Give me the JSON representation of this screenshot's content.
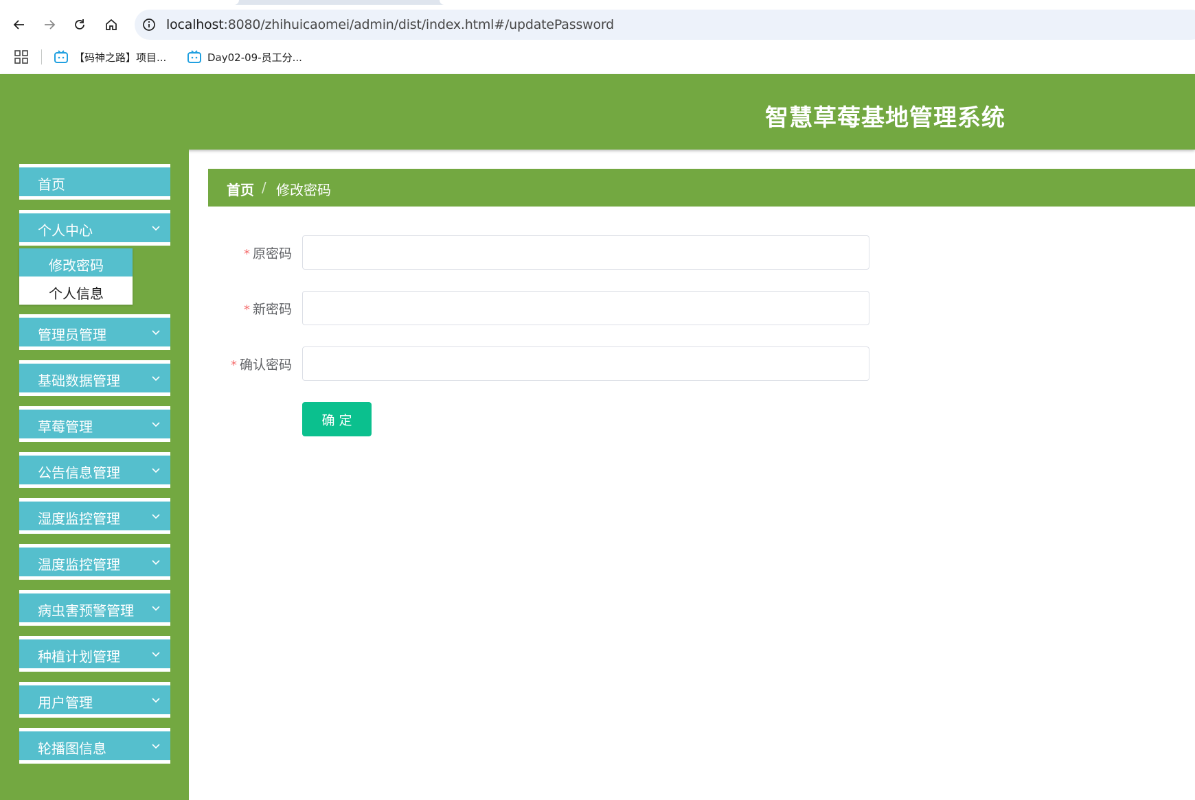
{
  "browser": {
    "url_host": "localhost",
    "url_rest": ":8080/zhihuicaomei/admin/dist/index.html#/updatePassword",
    "bookmarks": [
      {
        "label": "【码神之路】项目..."
      },
      {
        "label": "Day02-09-员工分..."
      }
    ],
    "accent": "#1a73e8"
  },
  "header": {
    "title": "智慧草莓基地管理系统",
    "bg_color": "#73a841"
  },
  "sidebar": {
    "items": [
      {
        "label": "首页",
        "has_chevron": false
      },
      {
        "label": "个人中心",
        "has_chevron": true,
        "expanded": true
      },
      {
        "label": "管理员管理",
        "has_chevron": true
      },
      {
        "label": "基础数据管理",
        "has_chevron": true
      },
      {
        "label": "草莓管理",
        "has_chevron": true
      },
      {
        "label": "公告信息管理",
        "has_chevron": true
      },
      {
        "label": "湿度监控管理",
        "has_chevron": true
      },
      {
        "label": "温度监控管理",
        "has_chevron": true
      },
      {
        "label": "病虫害预警管理",
        "has_chevron": true
      },
      {
        "label": "种植计划管理",
        "has_chevron": true
      },
      {
        "label": "用户管理",
        "has_chevron": true
      },
      {
        "label": "轮播图信息",
        "has_chevron": true
      }
    ],
    "submenu": [
      {
        "label": "修改密码",
        "active": true
      },
      {
        "label": "个人信息",
        "active": false
      }
    ],
    "item_color": "#55bfcd"
  },
  "breadcrumb": {
    "home": "首页",
    "separator": "/",
    "current": "修改密码"
  },
  "form": {
    "required_mark": "*",
    "fields": [
      {
        "label": "原密码",
        "value": ""
      },
      {
        "label": "新密码",
        "value": ""
      },
      {
        "label": "确认密码",
        "value": ""
      }
    ],
    "submit_label": "确定",
    "submit_color": "#0bc08e"
  }
}
